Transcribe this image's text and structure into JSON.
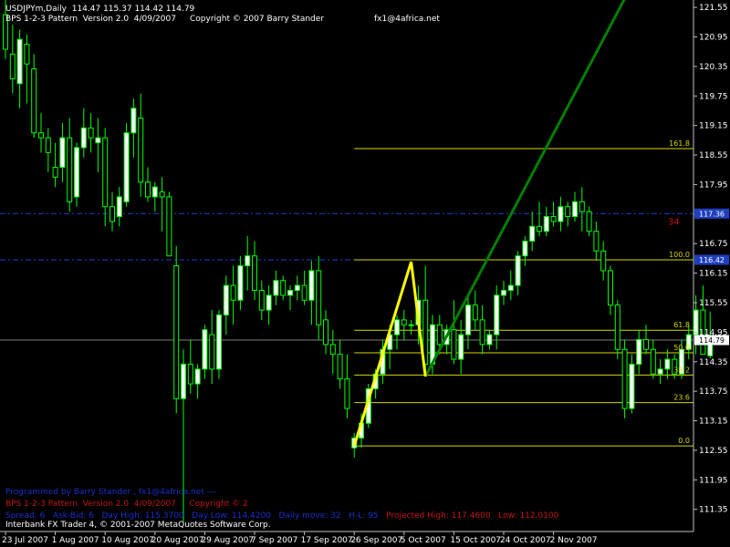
{
  "header": {
    "title": "USDJPYm,Daily  114.47 115.37 114.42 114.79",
    "subtitle": "BPS 1-2-3 Pattern  Version 2.0  4/09/2007",
    "copyright": "Copyright © 2007 Barry Stander",
    "email": "fx1@4africa.net"
  },
  "annotations": {
    "programmed_by": "Programmed by Barry Stander , fx1@4africa.net ---",
    "bps_line": "BPS 1-2-3 Pattern  Version 2.0  4/09/2007",
    "bps_copyright": "Copyright © 2",
    "spread": "Spread: 6",
    "ask_bid": "Ask-Bid: 6",
    "day_high": "Day High: 115.3700",
    "day_low": "Day Low: 114.4200",
    "daily_move": "Daily move: 32",
    "hl": "H-L: 95",
    "projected_high": "Projected High: 117.4600",
    "projected_low": "Low: 112.0100",
    "marker_34": "34"
  },
  "footer": "Interbank FX Trader 4, © 2001-2007 MetaQuotes Software Corp.",
  "colors": {
    "background": "#000000",
    "bull_candle": "#ffffff",
    "bear_candle": "#000000",
    "candle_outline": "#00ff00",
    "fib_lines": "#d7d700",
    "pattern_zigzag": "#ffff00",
    "trend_line": "#008000",
    "hline_blue": "#2040d0",
    "current_price_line": "#808080",
    "price_tag_blue": "#1f3fbf",
    "programmed_text": "#1c30c8",
    "bps_text": "#c41616",
    "marker_34": "#cc1111"
  },
  "chart_data": {
    "type": "candlestick",
    "symbol": "USDJPYm",
    "timeframe": "Daily",
    "ylim": [
      110.9,
      121.7
    ],
    "yticks": [
      121.55,
      120.95,
      120.35,
      119.75,
      119.15,
      118.55,
      117.95,
      117.35,
      116.75,
      116.15,
      115.55,
      114.95,
      114.35,
      113.75,
      113.15,
      112.55,
      111.95,
      111.35
    ],
    "ytick_labels": [
      "121.55",
      "120.95",
      "120.35",
      "119.75",
      "119.15",
      "118.55",
      "117.95",
      "117.35",
      "116.75",
      "116.15",
      "115.55",
      "114.95",
      "114.35",
      "113.75",
      "113.15",
      "112.55",
      "111.95",
      "111.35"
    ],
    "xtick_labels": [
      "23 Jul 2007",
      "1 Aug 2007",
      "10 Aug 2007",
      "20 Aug 2007",
      "29 Aug 2007",
      "7 Sep 2007",
      "17 Sep 2007",
      "26 Sep 2007",
      "5 Oct 2007",
      "15 Oct 2007",
      "24 Oct 2007",
      "2 Nov 2007"
    ],
    "xtick_bar_index": [
      0,
      7,
      14,
      21,
      28,
      35,
      42,
      49,
      56,
      63,
      70,
      77
    ],
    "candles": [
      {
        "o": 121.4,
        "h": 121.7,
        "l": 120.5,
        "c": 120.7
      },
      {
        "o": 120.6,
        "h": 121.2,
        "l": 119.8,
        "c": 120.1
      },
      {
        "o": 120.0,
        "h": 121.1,
        "l": 119.5,
        "c": 120.9
      },
      {
        "o": 120.8,
        "h": 121.0,
        "l": 119.6,
        "c": 120.4
      },
      {
        "o": 120.3,
        "h": 120.6,
        "l": 118.9,
        "c": 119.0
      },
      {
        "o": 119.0,
        "h": 119.4,
        "l": 118.6,
        "c": 118.9
      },
      {
        "o": 118.9,
        "h": 119.1,
        "l": 118.2,
        "c": 118.6
      },
      {
        "o": 118.3,
        "h": 118.8,
        "l": 117.9,
        "c": 118.1
      },
      {
        "o": 118.3,
        "h": 119.2,
        "l": 118.0,
        "c": 118.9
      },
      {
        "o": 118.9,
        "h": 119.3,
        "l": 117.4,
        "c": 117.6
      },
      {
        "o": 117.7,
        "h": 118.8,
        "l": 117.5,
        "c": 118.7
      },
      {
        "o": 118.7,
        "h": 119.5,
        "l": 118.5,
        "c": 119.1
      },
      {
        "o": 119.1,
        "h": 119.4,
        "l": 118.6,
        "c": 118.9
      },
      {
        "o": 118.8,
        "h": 119.3,
        "l": 118.2,
        "c": 118.9
      },
      {
        "o": 118.9,
        "h": 119.1,
        "l": 117.1,
        "c": 117.5
      },
      {
        "o": 117.5,
        "h": 117.8,
        "l": 117.0,
        "c": 117.2
      },
      {
        "o": 117.3,
        "h": 117.9,
        "l": 117.1,
        "c": 117.7
      },
      {
        "o": 117.6,
        "h": 119.2,
        "l": 117.5,
        "c": 119.0
      },
      {
        "o": 119.0,
        "h": 119.7,
        "l": 118.5,
        "c": 119.5
      },
      {
        "o": 119.3,
        "h": 119.8,
        "l": 117.7,
        "c": 118.0
      },
      {
        "o": 118.0,
        "h": 118.3,
        "l": 117.6,
        "c": 117.7
      },
      {
        "o": 117.7,
        "h": 118.0,
        "l": 117.4,
        "c": 117.9
      },
      {
        "o": 117.8,
        "h": 118.1,
        "l": 117.0,
        "c": 117.7
      },
      {
        "o": 117.7,
        "h": 117.8,
        "l": 116.6,
        "c": 116.5
      },
      {
        "o": 116.3,
        "h": 116.7,
        "l": 113.3,
        "c": 113.6
      },
      {
        "o": 113.6,
        "h": 114.6,
        "l": 111.1,
        "c": 114.3
      },
      {
        "o": 114.3,
        "h": 114.8,
        "l": 113.7,
        "c": 113.9
      },
      {
        "o": 113.9,
        "h": 114.3,
        "l": 113.6,
        "c": 114.2
      },
      {
        "o": 114.2,
        "h": 115.1,
        "l": 114.0,
        "c": 115.0
      },
      {
        "o": 114.9,
        "h": 115.4,
        "l": 113.9,
        "c": 114.2
      },
      {
        "o": 114.2,
        "h": 115.4,
        "l": 114.0,
        "c": 115.3
      },
      {
        "o": 115.3,
        "h": 116.1,
        "l": 114.9,
        "c": 115.9
      },
      {
        "o": 115.9,
        "h": 116.3,
        "l": 115.1,
        "c": 115.6
      },
      {
        "o": 115.6,
        "h": 116.5,
        "l": 115.4,
        "c": 116.3
      },
      {
        "o": 116.3,
        "h": 116.9,
        "l": 115.8,
        "c": 116.5
      },
      {
        "o": 116.5,
        "h": 116.8,
        "l": 115.6,
        "c": 115.8
      },
      {
        "o": 115.8,
        "h": 116.0,
        "l": 115.2,
        "c": 115.4
      },
      {
        "o": 115.4,
        "h": 115.9,
        "l": 115.1,
        "c": 115.7
      },
      {
        "o": 115.7,
        "h": 116.2,
        "l": 115.5,
        "c": 116.0
      },
      {
        "o": 116.0,
        "h": 116.1,
        "l": 115.6,
        "c": 115.7
      },
      {
        "o": 115.7,
        "h": 115.9,
        "l": 115.4,
        "c": 115.8
      },
      {
        "o": 115.8,
        "h": 116.1,
        "l": 115.6,
        "c": 115.9
      },
      {
        "o": 115.9,
        "h": 116.2,
        "l": 115.5,
        "c": 115.6
      },
      {
        "o": 115.6,
        "h": 116.4,
        "l": 115.1,
        "c": 116.2
      },
      {
        "o": 116.2,
        "h": 116.5,
        "l": 114.8,
        "c": 115.1
      },
      {
        "o": 115.2,
        "h": 115.4,
        "l": 114.5,
        "c": 114.7
      },
      {
        "o": 114.7,
        "h": 115.0,
        "l": 114.1,
        "c": 114.5
      },
      {
        "o": 114.5,
        "h": 114.8,
        "l": 113.8,
        "c": 114.0
      },
      {
        "o": 114.0,
        "h": 114.5,
        "l": 113.2,
        "c": 113.4
      },
      {
        "o": 112.6,
        "h": 112.9,
        "l": 112.4,
        "c": 112.8
      },
      {
        "o": 112.8,
        "h": 113.3,
        "l": 112.6,
        "c": 113.1
      },
      {
        "o": 113.1,
        "h": 113.9,
        "l": 113.0,
        "c": 113.8
      },
      {
        "o": 113.8,
        "h": 114.2,
        "l": 113.6,
        "c": 114.1
      },
      {
        "o": 114.1,
        "h": 114.8,
        "l": 113.9,
        "c": 114.6
      },
      {
        "o": 114.6,
        "h": 115.1,
        "l": 114.2,
        "c": 114.9
      },
      {
        "o": 114.9,
        "h": 115.3,
        "l": 114.6,
        "c": 115.2
      },
      {
        "o": 115.2,
        "h": 115.4,
        "l": 114.8,
        "c": 115.1
      },
      {
        "o": 115.1,
        "h": 115.2,
        "l": 114.9,
        "c": 115.1
      },
      {
        "o": 115.1,
        "h": 115.9,
        "l": 114.7,
        "c": 115.6
      },
      {
        "o": 115.6,
        "h": 116.3,
        "l": 114.1,
        "c": 114.3
      },
      {
        "o": 114.3,
        "h": 115.3,
        "l": 114.1,
        "c": 115.1
      },
      {
        "o": 115.1,
        "h": 115.3,
        "l": 114.5,
        "c": 114.7
      },
      {
        "o": 114.7,
        "h": 115.1,
        "l": 114.5,
        "c": 115.0
      },
      {
        "o": 115.0,
        "h": 115.6,
        "l": 114.3,
        "c": 114.4
      },
      {
        "o": 114.4,
        "h": 115.2,
        "l": 114.1,
        "c": 114.9
      },
      {
        "o": 114.9,
        "h": 115.7,
        "l": 114.6,
        "c": 115.5
      },
      {
        "o": 115.5,
        "h": 115.8,
        "l": 115.0,
        "c": 115.2
      },
      {
        "o": 115.2,
        "h": 115.5,
        "l": 114.5,
        "c": 114.7
      },
      {
        "o": 114.7,
        "h": 115.0,
        "l": 114.6,
        "c": 114.9
      },
      {
        "o": 114.9,
        "h": 115.9,
        "l": 114.6,
        "c": 115.7
      },
      {
        "o": 115.7,
        "h": 116.0,
        "l": 115.5,
        "c": 115.8
      },
      {
        "o": 115.8,
        "h": 116.2,
        "l": 115.6,
        "c": 115.9
      },
      {
        "o": 115.9,
        "h": 116.6,
        "l": 115.7,
        "c": 116.5
      },
      {
        "o": 116.5,
        "h": 116.9,
        "l": 116.3,
        "c": 116.8
      },
      {
        "o": 116.8,
        "h": 117.4,
        "l": 116.6,
        "c": 117.1
      },
      {
        "o": 117.1,
        "h": 117.6,
        "l": 116.9,
        "c": 117.0
      },
      {
        "o": 117.0,
        "h": 117.5,
        "l": 116.9,
        "c": 117.3
      },
      {
        "o": 117.3,
        "h": 117.6,
        "l": 117.1,
        "c": 117.2
      },
      {
        "o": 117.2,
        "h": 117.7,
        "l": 117.0,
        "c": 117.5
      },
      {
        "o": 117.5,
        "h": 117.6,
        "l": 117.1,
        "c": 117.3
      },
      {
        "o": 117.3,
        "h": 117.8,
        "l": 117.2,
        "c": 117.6
      },
      {
        "o": 117.6,
        "h": 117.9,
        "l": 117.0,
        "c": 117.4
      },
      {
        "o": 117.4,
        "h": 117.5,
        "l": 116.9,
        "c": 117.0
      },
      {
        "o": 117.0,
        "h": 117.2,
        "l": 116.4,
        "c": 116.6
      },
      {
        "o": 116.6,
        "h": 116.8,
        "l": 116.0,
        "c": 116.2
      },
      {
        "o": 116.2,
        "h": 116.3,
        "l": 115.3,
        "c": 115.5
      },
      {
        "o": 115.5,
        "h": 115.6,
        "l": 114.4,
        "c": 114.6
      },
      {
        "o": 114.6,
        "h": 114.8,
        "l": 113.2,
        "c": 113.4
      },
      {
        "o": 113.4,
        "h": 114.5,
        "l": 113.3,
        "c": 114.3
      },
      {
        "o": 114.3,
        "h": 115.0,
        "l": 114.1,
        "c": 114.8
      },
      {
        "o": 114.8,
        "h": 115.1,
        "l": 114.5,
        "c": 114.6
      },
      {
        "o": 114.6,
        "h": 114.8,
        "l": 114.0,
        "c": 114.1
      },
      {
        "o": 114.1,
        "h": 114.4,
        "l": 113.9,
        "c": 114.2
      },
      {
        "o": 114.2,
        "h": 114.6,
        "l": 114.0,
        "c": 114.4
      },
      {
        "o": 114.4,
        "h": 114.5,
        "l": 114.0,
        "c": 114.1
      },
      {
        "o": 114.1,
        "h": 114.8,
        "l": 114.0,
        "c": 114.6
      },
      {
        "o": 114.6,
        "h": 115.1,
        "l": 114.4,
        "c": 114.9
      },
      {
        "o": 114.9,
        "h": 115.7,
        "l": 114.5,
        "c": 115.4
      },
      {
        "o": 115.4,
        "h": 115.9,
        "l": 114.6,
        "c": 114.5
      },
      {
        "o": 114.47,
        "h": 115.37,
        "l": 114.42,
        "c": 114.79
      }
    ],
    "fib_levels": [
      {
        "label": "161.8",
        "price": 118.68
      },
      {
        "label": "100.0",
        "price": 116.42
      },
      {
        "label": "61.8",
        "price": 114.99
      },
      {
        "label": "50.0",
        "price": 114.53
      },
      {
        "label": "38.2",
        "price": 114.08
      },
      {
        "label": "23.6",
        "price": 113.52
      },
      {
        "label": "0.0",
        "price": 112.64
      }
    ],
    "fib_start_bar": 49,
    "pattern_points": [
      {
        "bar": 49,
        "price": 112.64
      },
      {
        "bar": 57,
        "price": 116.38
      },
      {
        "bar": 59,
        "price": 114.05
      }
    ],
    "trend_line": [
      {
        "bar": 59,
        "price": 114.05
      },
      {
        "bar": 88,
        "price": 122.0
      }
    ],
    "hlines": [
      {
        "price": 117.36,
        "label": "117.36"
      },
      {
        "price": 116.42,
        "label": "116.42"
      }
    ],
    "current_price": 114.79,
    "current_price_label": "114.79"
  }
}
